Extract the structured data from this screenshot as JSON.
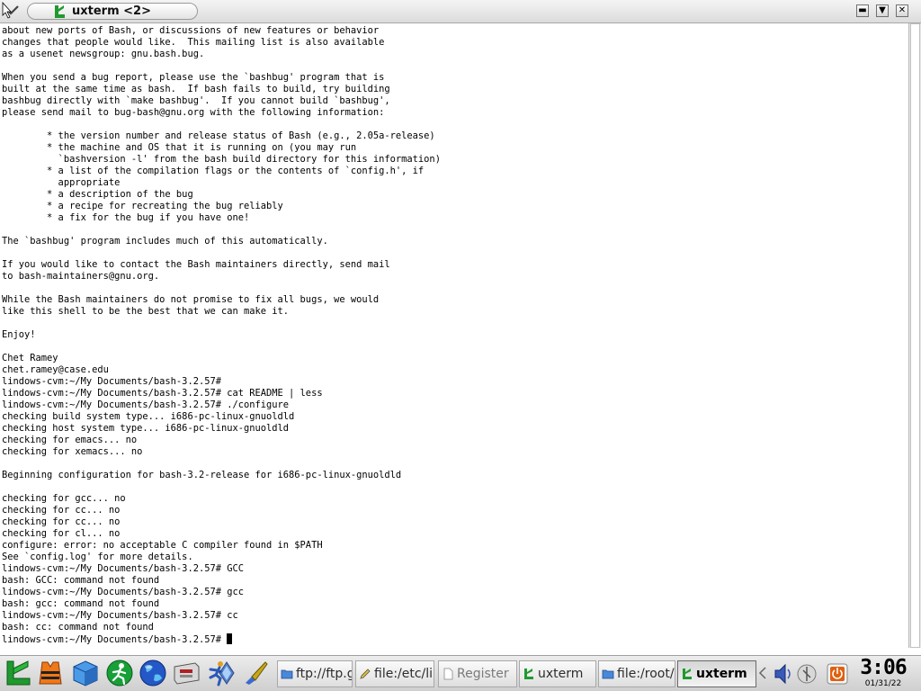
{
  "window": {
    "title": "uxterm <2>",
    "menu_icon": "chevron-down-icon",
    "logo_icon": "lindows-logo-icon",
    "controls": {
      "minimize_icon": "minimize-icon",
      "shade_icon": "shade-icon",
      "close_icon": "close-icon"
    }
  },
  "terminal": {
    "lines": [
      "about new ports of Bash, or discussions of new features or behavior",
      "changes that people would like.  This mailing list is also available",
      "as a usenet newsgroup: gnu.bash.bug.",
      "",
      "When you send a bug report, please use the `bashbug' program that is",
      "built at the same time as bash.  If bash fails to build, try building",
      "bashbug directly with `make bashbug'.  If you cannot build `bashbug',",
      "please send mail to bug-bash@gnu.org with the following information:",
      "",
      "        * the version number and release status of Bash (e.g., 2.05a-release)",
      "        * the machine and OS that it is running on (you may run",
      "          `bashversion -l' from the bash build directory for this information)",
      "        * a list of the compilation flags or the contents of `config.h', if",
      "          appropriate",
      "        * a description of the bug",
      "        * a recipe for recreating the bug reliably",
      "        * a fix for the bug if you have one!",
      "",
      "The `bashbug' program includes much of this automatically.",
      "",
      "If you would like to contact the Bash maintainers directly, send mail",
      "to bash-maintainers@gnu.org.",
      "",
      "While the Bash maintainers do not promise to fix all bugs, we would",
      "like this shell to be the best that we can make it.",
      "",
      "Enjoy!",
      "",
      "Chet Ramey",
      "chet.ramey@case.edu",
      "lindows-cvm:~/My Documents/bash-3.2.57#",
      "lindows-cvm:~/My Documents/bash-3.2.57# cat README | less",
      "lindows-cvm:~/My Documents/bash-3.2.57# ./configure",
      "checking build system type... i686-pc-linux-gnuoldld",
      "checking host system type... i686-pc-linux-gnuoldld",
      "checking for emacs... no",
      "checking for xemacs... no",
      "",
      "Beginning configuration for bash-3.2-release for i686-pc-linux-gnuoldld",
      "",
      "checking for gcc... no",
      "checking for cc... no",
      "checking for cc... no",
      "checking for cl... no",
      "configure: error: no acceptable C compiler found in $PATH",
      "See `config.log' for more details.",
      "lindows-cvm:~/My Documents/bash-3.2.57# GCC",
      "bash: GCC: command not found",
      "lindows-cvm:~/My Documents/bash-3.2.57# gcc",
      "bash: gcc: command not found",
      "lindows-cvm:~/My Documents/bash-3.2.57# cc",
      "bash: cc: command not found"
    ],
    "prompt": "lindows-cvm:~/My Documents/bash-3.2.57# "
  },
  "taskbar": {
    "launchers": [
      {
        "name": "lindows-start-icon",
        "color": "#1f9a2e"
      },
      {
        "name": "life-vest-icon",
        "color": "#f07818"
      },
      {
        "name": "cube-icon",
        "color": "#2a78d0"
      },
      {
        "name": "running-person-icon",
        "color": "#18a038"
      },
      {
        "name": "globe-icon",
        "color": "#2458c8"
      },
      {
        "name": "file-cabinet-icon",
        "color": "#b02020"
      },
      {
        "name": "runner-icon",
        "color": "#e0a020"
      },
      {
        "name": "network-icon",
        "color": "#3a70c8"
      },
      {
        "name": "paintbrush-icon",
        "color": "#c8a818"
      }
    ],
    "tasks": [
      {
        "label": "ftp://ftp.gr",
        "icon": "folder-icon",
        "state": "normal"
      },
      {
        "label": "file:/etc/lin",
        "icon": "pencil-icon",
        "state": "normal"
      },
      {
        "label": "Register",
        "icon": "document-icon",
        "state": "dim"
      },
      {
        "label": "uxterm",
        "icon": "lindows-logo-icon",
        "state": "normal"
      },
      {
        "label": "file:/root/",
        "icon": "folder-icon",
        "state": "normal"
      },
      {
        "label": "uxterm",
        "icon": "lindows-logo-icon",
        "state": "active"
      }
    ],
    "scroll_left_icon": "chevron-left-icon",
    "tray": [
      {
        "name": "speaker-icon"
      },
      {
        "name": "network-status-icon"
      },
      {
        "name": "power-icon",
        "color": "#e06010"
      }
    ],
    "clock": {
      "time": "3:06",
      "date": "01/31/22"
    }
  }
}
